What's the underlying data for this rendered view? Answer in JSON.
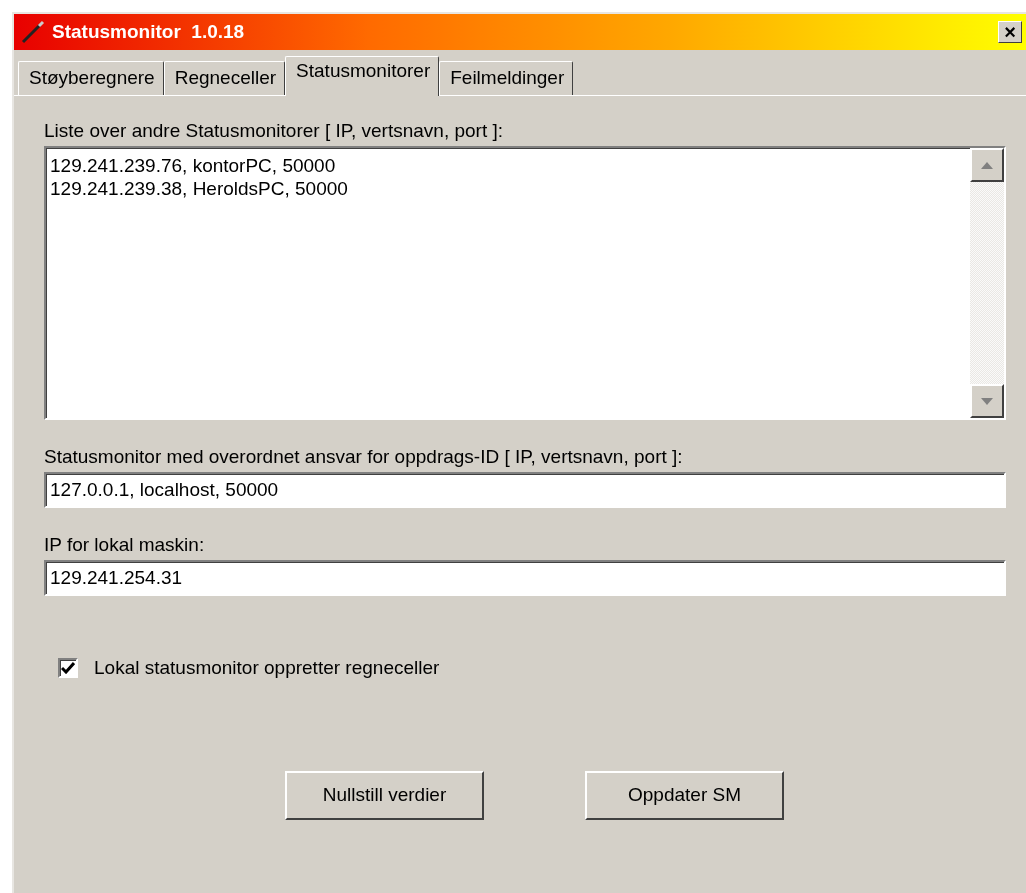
{
  "window": {
    "title": "Statusmonitor  1.0.18",
    "close": "×"
  },
  "tabs": [
    {
      "label": "Støyberegnere",
      "selected": false
    },
    {
      "label": "Regneceller",
      "selected": false
    },
    {
      "label": "Statusmonitorer",
      "selected": true
    },
    {
      "label": "Feilmeldinger",
      "selected": false
    }
  ],
  "monitor_list": {
    "label": "Liste over andre Statusmonitorer  [ IP,  vertsnavn,  port ]:",
    "lines": [
      "129.241.239.76, kontorPC, 50000",
      "129.241.239.38, HeroldsPC, 50000"
    ]
  },
  "fields": [
    {
      "label": "Statusmonitor med overordnet ansvar for oppdrags-ID  [ IP,  vertsnavn,  port ]:",
      "value": "127.0.0.1, localhost, 50000"
    },
    {
      "label": "IP for lokal maskin:",
      "value": "129.241.254.31"
    }
  ],
  "checkbox": {
    "label": "Lokal statusmonitor oppretter regneceller",
    "checked": true
  },
  "buttons": [
    "Nullstill verdier",
    "Oppdater SM"
  ]
}
